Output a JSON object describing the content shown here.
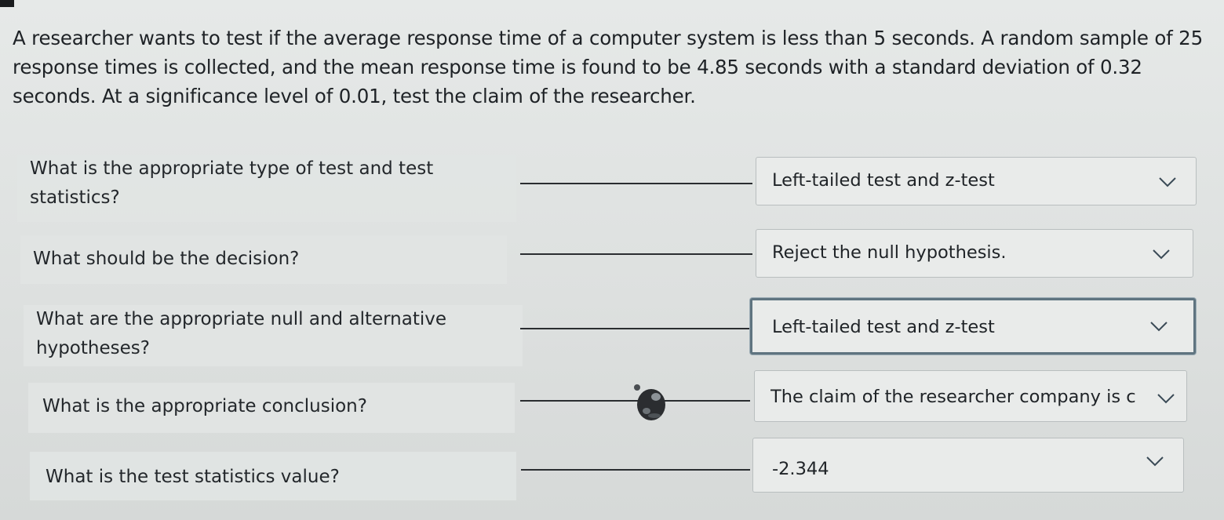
{
  "question": {
    "text": "A researcher wants to test if the average response time of a computer system is less than 5 seconds. A random sample of 25 response times is collected, and the mean response time is found to be 4.85 seconds with a standard deviation of 0.32 seconds. At a significance level of 0.01, test the claim of the researcher."
  },
  "matches": [
    {
      "prompt": "What is the appropriate type of test and test statistics?",
      "selected": "Left-tailed test and z-test"
    },
    {
      "prompt": "What should be the decision?",
      "selected": "Reject the null hypothesis."
    },
    {
      "prompt": "What are the appropriate null and alternative hypotheses?",
      "selected": "Left-tailed test and z-test"
    },
    {
      "prompt": "What is the appropriate conclusion?",
      "selected": "The claim of the researcher company is c"
    },
    {
      "prompt": "What is the test statistics value?",
      "selected": "-2.344"
    }
  ],
  "icons": {
    "dropdown": "chevron-down-icon",
    "cursor": "cursor-icon"
  },
  "colors": {
    "focus_border": "#5f7480",
    "line": "#2a2d30"
  }
}
